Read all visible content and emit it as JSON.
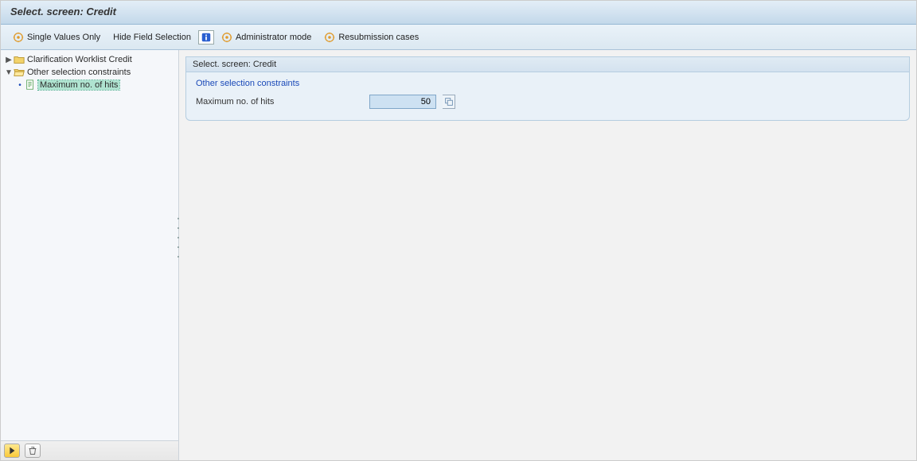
{
  "colors": {
    "accent": "#1a49b8",
    "header_grad_from": "#e3eef7",
    "header_grad_to": "#c3d8ea",
    "selection_bg": "#afe3d0"
  },
  "title": "Select. screen: Credit",
  "toolbar": {
    "single_values": "Single Values Only",
    "hide_field_selection": "Hide Field Selection",
    "info_icon": "info-icon",
    "administrator_mode": "Administrator mode",
    "resubmission": "Resubmission cases"
  },
  "tree": {
    "items": [
      {
        "id": "clarification",
        "expander": "▶",
        "icon": "folder-closed-icon",
        "label": "Clarification Worklist Credit",
        "level": 0,
        "selected": false
      },
      {
        "id": "other-constraints",
        "expander": "▼",
        "icon": "folder-open-icon",
        "label": "Other selection constraints",
        "level": 0,
        "selected": false
      },
      {
        "id": "max-hits",
        "expander": "•",
        "icon": "document-icon",
        "label": "Maximum no. of hits",
        "level": 1,
        "selected": true
      }
    ],
    "footer": {
      "play_icon": "play-icon",
      "trash_icon": "trash-icon"
    }
  },
  "main": {
    "group_header": "Select. screen: Credit",
    "group_title": "Other selection constraints",
    "rows": [
      {
        "label": "Maximum no. of hits",
        "value": "50"
      }
    ]
  }
}
